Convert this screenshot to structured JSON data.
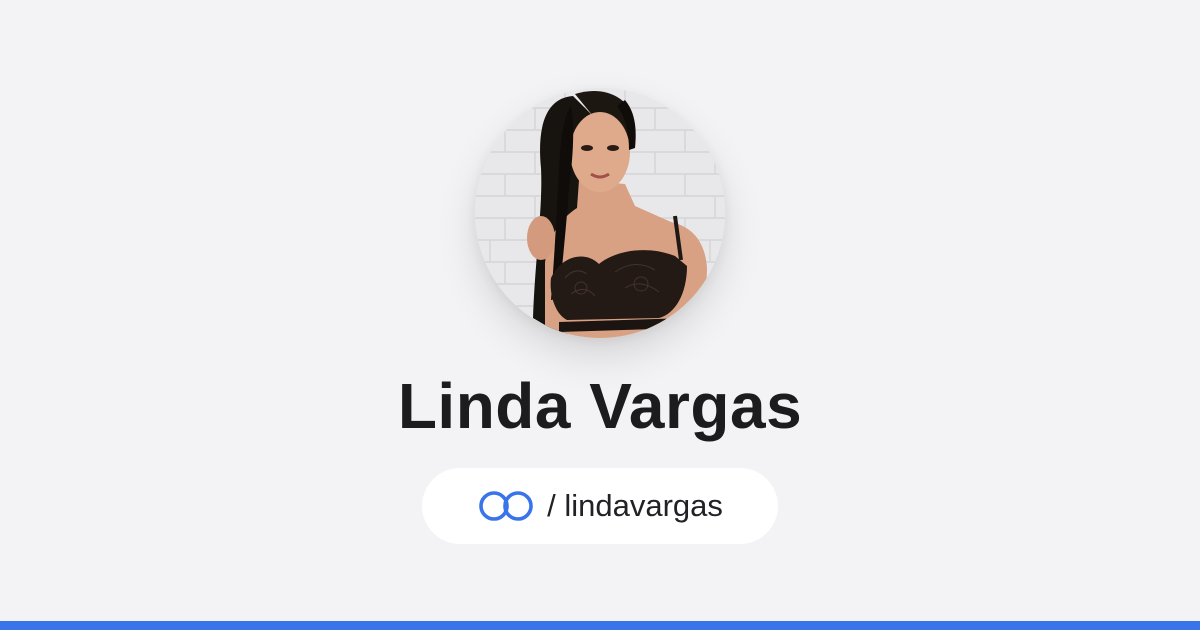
{
  "profile": {
    "name": "Linda Vargas",
    "handle_separator": "/",
    "handle": "lindavargas",
    "avatar_alt": "Linda Vargas"
  },
  "icons": {
    "link": "linktree-link-icon"
  },
  "colors": {
    "background": "#f3f3f5",
    "accent": "#3a74ea",
    "name_text": "#1c1c1e",
    "pill_background": "#ffffff"
  }
}
